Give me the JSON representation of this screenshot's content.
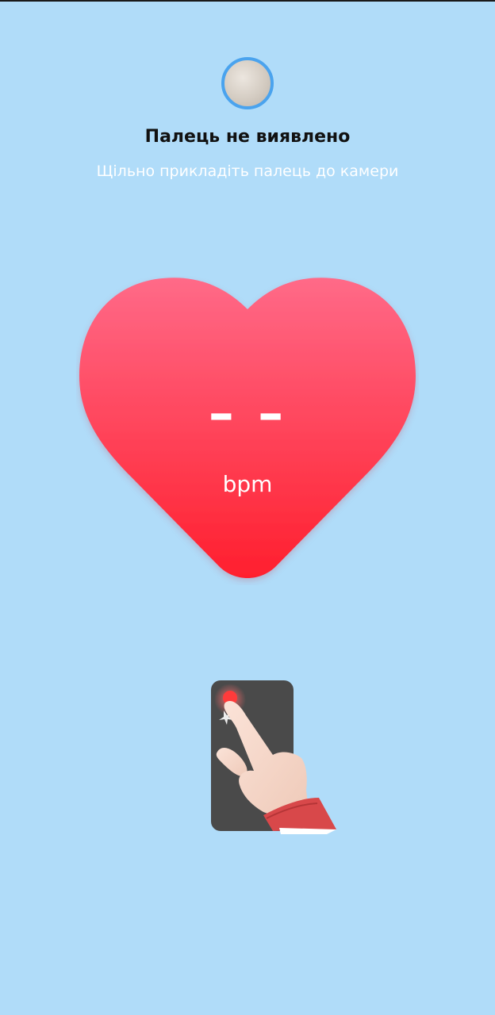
{
  "status": {
    "title": "Палець не виявлено",
    "hint": "Щільно прикладіть палець до камери"
  },
  "measurement": {
    "value": "– –",
    "unit": "bpm"
  },
  "colors": {
    "background": "#b0dcf9",
    "heart_top": "#ff6a88",
    "heart_bottom": "#ff1f2e",
    "camera_ring": "#4aa3ee"
  },
  "icons": {
    "camera_preview": "camera-preview-circle",
    "heart": "heart-icon",
    "illustration": "finger-on-camera-illustration"
  }
}
